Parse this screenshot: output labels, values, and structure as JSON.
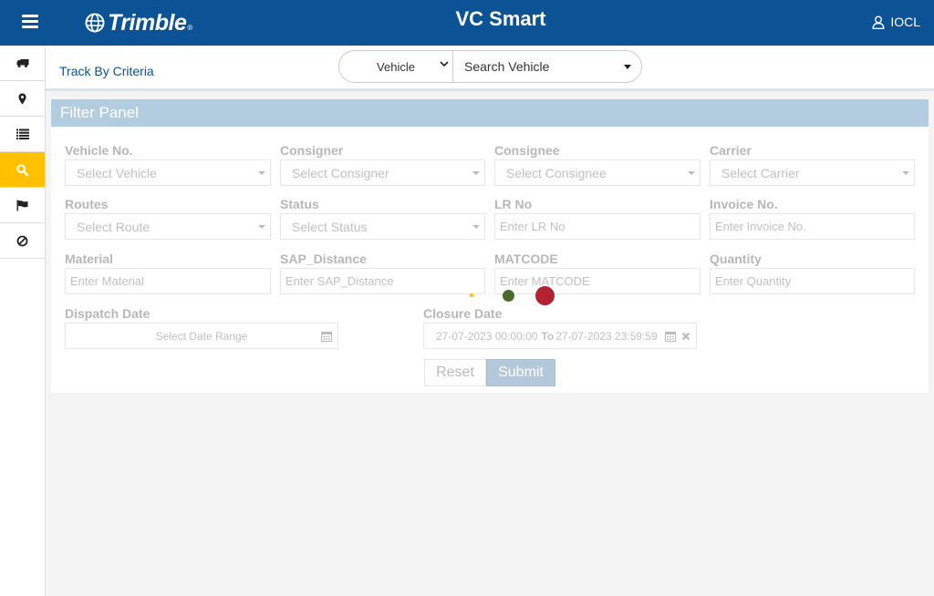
{
  "header": {
    "app_title": "VC Smart",
    "logo_text": "Trimble",
    "logo_mark": "®",
    "user_label": "IOCL",
    "colors": {
      "header_bg": "#0b5394",
      "active_nav": "#ffc000"
    }
  },
  "sidebar": {
    "items": [
      {
        "icon": "truck-icon"
      },
      {
        "icon": "map-marker-icon"
      },
      {
        "icon": "list-icon"
      },
      {
        "icon": "search-icon",
        "active": true
      },
      {
        "icon": "flag-icon"
      },
      {
        "icon": "ban-icon"
      }
    ]
  },
  "topbar": {
    "track_link": "Track By Criteria",
    "search_type": "Vehicle",
    "search_vehicle": "Search Vehicle"
  },
  "filter": {
    "title": "Filter Panel",
    "vehicle_no": {
      "label": "Vehicle No.",
      "placeholder": "Select Vehicle"
    },
    "consigner": {
      "label": "Consigner",
      "placeholder": "Select Consigner"
    },
    "consignee": {
      "label": "Consignee",
      "placeholder": "Select Consignee"
    },
    "carrier": {
      "label": "Carrier",
      "placeholder": "Select Carrier"
    },
    "routes": {
      "label": "Routes",
      "placeholder": "Select Route"
    },
    "status": {
      "label": "Status",
      "placeholder": "Select Status"
    },
    "lr_no": {
      "label": "LR No",
      "placeholder": "Enter LR No"
    },
    "invoice_no": {
      "label": "Invoice No.",
      "placeholder": "Enter Invoice No."
    },
    "material": {
      "label": "Material",
      "placeholder": "Enter Material"
    },
    "sap_distance": {
      "label": "SAP_Distance",
      "placeholder": "Enter SAP_Distance"
    },
    "matcode": {
      "label": "MATCODE",
      "placeholder": "Enter MATCODE"
    },
    "quantity": {
      "label": "Quantity",
      "placeholder": "Enter Quantity"
    },
    "dispatch_date": {
      "label": "Dispatch Date",
      "placeholder": "Select Date Range"
    },
    "closure_date": {
      "label": "Closure Date",
      "from": "27-07-2023 00:00:00",
      "to_word": "To",
      "to": "27-07-2023 23:59:59"
    },
    "reset_label": "Reset",
    "submit_label": "Submit"
  },
  "loader": {
    "dot_colors": [
      "#ffc000",
      "#4a6b2b",
      "#b22231"
    ]
  }
}
